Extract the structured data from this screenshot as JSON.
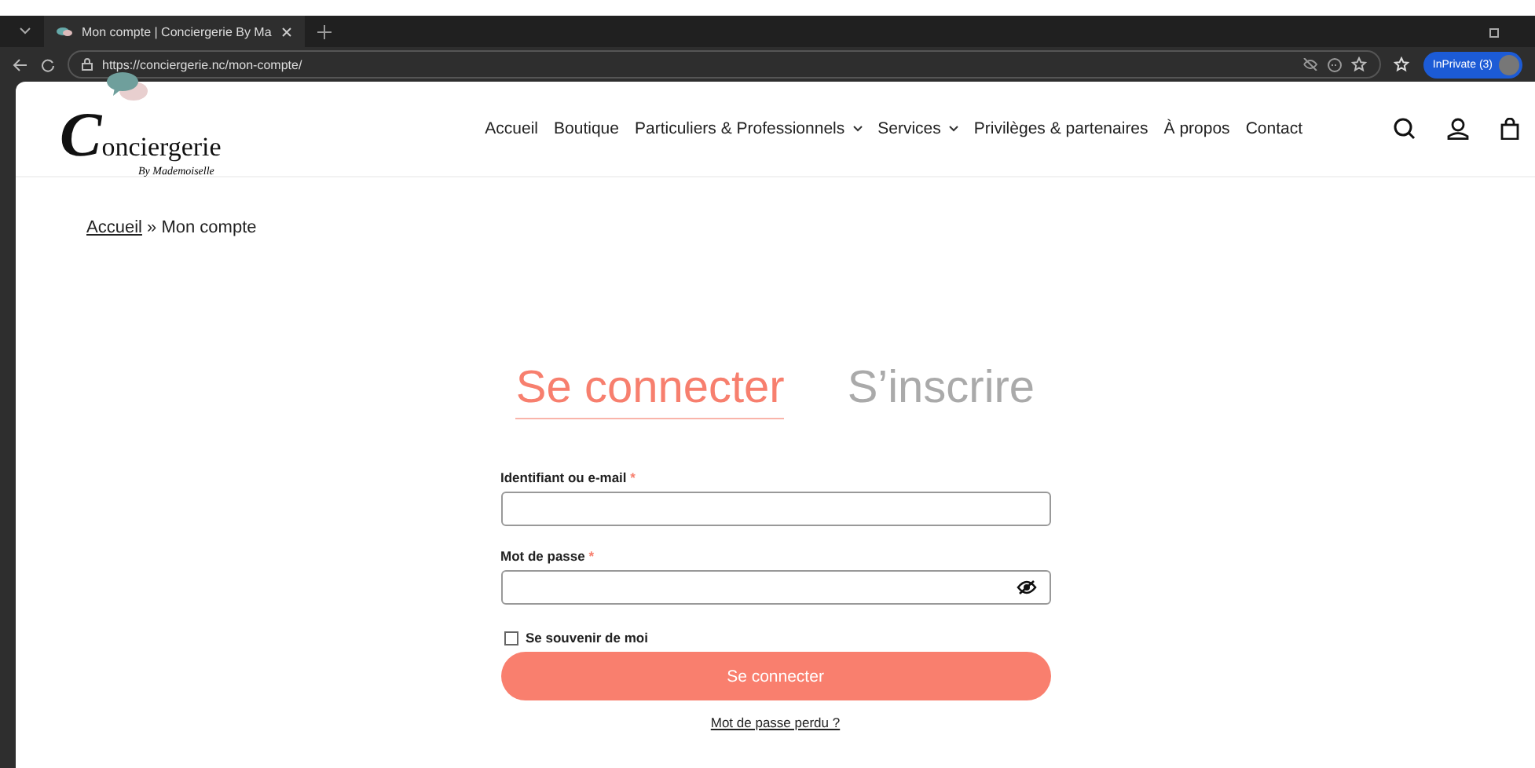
{
  "browser": {
    "tab_title": "Mon compte | Conciergerie By Ma",
    "url": "https://conciergerie.nc/mon-compte/",
    "profile": "InPrivate (3)"
  },
  "header": {
    "logo": {
      "title": "Conciergerie",
      "subtitle": "By Mademoiselle"
    },
    "nav": [
      {
        "label": "Accueil",
        "dropdown": false
      },
      {
        "label": "Boutique",
        "dropdown": false
      },
      {
        "label": "Particuliers & Professionnels",
        "dropdown": true
      },
      {
        "label": "Services",
        "dropdown": true
      },
      {
        "label": "Privilèges & partenaires",
        "dropdown": false
      },
      {
        "label": "À propos",
        "dropdown": false
      },
      {
        "label": "Contact",
        "dropdown": false
      }
    ]
  },
  "breadcrumb": {
    "link": "Accueil",
    "separator": "»",
    "current": "Mon compte"
  },
  "tabs": [
    {
      "label": "Se connecter",
      "selected": true
    },
    {
      "label": "S’inscrire",
      "selected": false
    }
  ],
  "form": {
    "fields": [
      {
        "label": "Identifiant ou e-mail",
        "required_mark": "*",
        "kind": "text"
      },
      {
        "label": "Mot de passe",
        "required_mark": "*",
        "kind": "password"
      }
    ],
    "remember": {
      "label": "Se souvenir de moi",
      "checked": false
    },
    "submit": "Se connecter",
    "lost_password": "Mot de passe perdu ?"
  }
}
